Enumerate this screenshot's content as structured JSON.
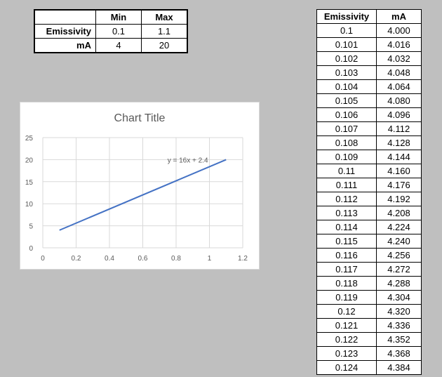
{
  "minmax": {
    "headers": [
      "",
      "Min",
      "Max"
    ],
    "rows": [
      {
        "label": "Emissivity",
        "min": "0.1",
        "max": "1.1"
      },
      {
        "label": "mA",
        "min": "4",
        "max": "20"
      }
    ]
  },
  "chart_data": {
    "type": "line",
    "title": "Chart Title",
    "x": [
      0.1,
      1.1
    ],
    "series": [
      {
        "values": [
          4,
          20
        ],
        "color": "#4472c4"
      }
    ],
    "xlim": [
      0,
      1.2
    ],
    "ylim": [
      0,
      25
    ],
    "xticks": [
      "0",
      "0.2",
      "0.4",
      "0.6",
      "0.8",
      "1",
      "1.2"
    ],
    "xtick_values": [
      0,
      0.2,
      0.4,
      0.6,
      0.8,
      1,
      1.2
    ],
    "yticks": [
      "0",
      "5",
      "10",
      "15",
      "20",
      "25"
    ],
    "ytick_values": [
      0,
      5,
      10,
      15,
      20,
      25
    ],
    "grid": true,
    "trendline_label": "y = 16x + 2.4"
  },
  "datatable": {
    "headers": [
      "Emissivity",
      "mA"
    ],
    "rows": [
      [
        "0.1",
        "4.000"
      ],
      [
        "0.101",
        "4.016"
      ],
      [
        "0.102",
        "4.032"
      ],
      [
        "0.103",
        "4.048"
      ],
      [
        "0.104",
        "4.064"
      ],
      [
        "0.105",
        "4.080"
      ],
      [
        "0.106",
        "4.096"
      ],
      [
        "0.107",
        "4.112"
      ],
      [
        "0.108",
        "4.128"
      ],
      [
        "0.109",
        "4.144"
      ],
      [
        "0.11",
        "4.160"
      ],
      [
        "0.111",
        "4.176"
      ],
      [
        "0.112",
        "4.192"
      ],
      [
        "0.113",
        "4.208"
      ],
      [
        "0.114",
        "4.224"
      ],
      [
        "0.115",
        "4.240"
      ],
      [
        "0.116",
        "4.256"
      ],
      [
        "0.117",
        "4.272"
      ],
      [
        "0.118",
        "4.288"
      ],
      [
        "0.119",
        "4.304"
      ],
      [
        "0.12",
        "4.320"
      ],
      [
        "0.121",
        "4.336"
      ],
      [
        "0.122",
        "4.352"
      ],
      [
        "0.123",
        "4.368"
      ],
      [
        "0.124",
        "4.384"
      ]
    ]
  }
}
